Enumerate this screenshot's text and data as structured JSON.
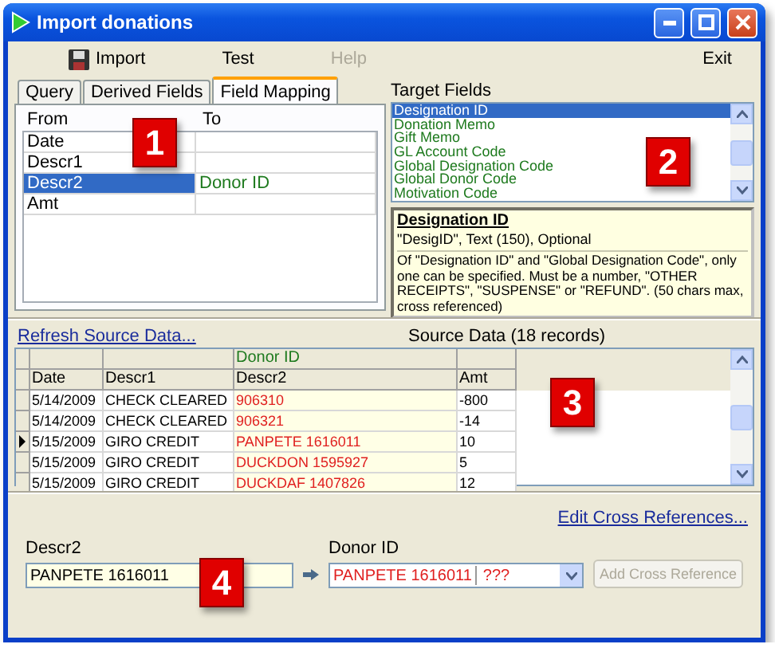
{
  "window": {
    "title": "Import donations"
  },
  "toolbar": [
    {
      "label": "Import",
      "disabled": false,
      "kind": "icon"
    },
    {
      "label": "Test",
      "disabled": false,
      "kind": "text"
    },
    {
      "label": "Help",
      "disabled": true,
      "kind": "text"
    },
    {
      "label": "Exit",
      "disabled": false,
      "kind": "text"
    }
  ],
  "tabs": [
    {
      "label": "Query",
      "selected": false
    },
    {
      "label": "Derived Fields",
      "selected": false
    },
    {
      "label": "Field Mapping",
      "selected": true
    }
  ],
  "mapping": {
    "columns": [
      "From",
      "To"
    ],
    "rows": [
      {
        "from": "Date",
        "to": "",
        "selected": false
      },
      {
        "from": "Descr1",
        "to": "",
        "selected": false
      },
      {
        "from": "Descr2",
        "to": "Donor ID",
        "selected": true
      },
      {
        "from": "Amt",
        "to": "",
        "selected": false
      }
    ]
  },
  "target_fields": {
    "label": "Target Fields",
    "items": [
      {
        "label": "Designation ID",
        "selected": true
      },
      {
        "label": "Donation Memo",
        "selected": false
      },
      {
        "label": "Gift Memo",
        "selected": false
      },
      {
        "label": "GL Account Code",
        "selected": false
      },
      {
        "label": "Global Designation Code",
        "selected": false
      },
      {
        "label": "Global Donor Code",
        "selected": false
      },
      {
        "label": "Motivation Code",
        "selected": false
      }
    ]
  },
  "field_info": {
    "title": "Designation ID",
    "summary": "\"DesigID\", Text (150), Optional",
    "description": "Of \"Designation ID\" and \"Global Designation Code\", only one can be specified.  Must be a number, \"OTHER RECEIPTS\", \"SUSPENSE\" or \"REFUND\".   (50 chars max, cross referenced)"
  },
  "source": {
    "refresh_link": "Refresh Source Data...",
    "title": "Source Data (18 records)",
    "group_header": "Donor ID",
    "columns": [
      "Date",
      "Descr1",
      "Descr2",
      "Amt"
    ],
    "rows": [
      {
        "date": "5/14/2009",
        "descr1": "CHECK CLEARED",
        "descr2": "906310",
        "amt": "-800",
        "current": false
      },
      {
        "date": "5/14/2009",
        "descr1": "CHECK CLEARED",
        "descr2": "906321",
        "amt": "-14",
        "current": false
      },
      {
        "date": "5/15/2009",
        "descr1": "GIRO CREDIT",
        "descr2": "PANPETE 1616011",
        "amt": "10",
        "current": true
      },
      {
        "date": "5/15/2009",
        "descr1": "GIRO CREDIT",
        "descr2": "DUCKDON 1595927",
        "amt": "5",
        "current": false
      },
      {
        "date": "5/15/2009",
        "descr1": "GIRO CREDIT",
        "descr2": "DUCKDAF 1407826",
        "amt": "12",
        "current": false
      }
    ]
  },
  "cross_reference": {
    "edit_link": "Edit Cross References...",
    "source_label": "Descr2",
    "source_value": "PANPETE 1616011",
    "target_label": "Donor ID",
    "target_value": "PANPETE 1616011",
    "target_suffix": "???",
    "add_button": {
      "label": "Add Cross Reference",
      "disabled": true
    }
  },
  "callouts": [
    "1",
    "2",
    "3",
    "4"
  ]
}
